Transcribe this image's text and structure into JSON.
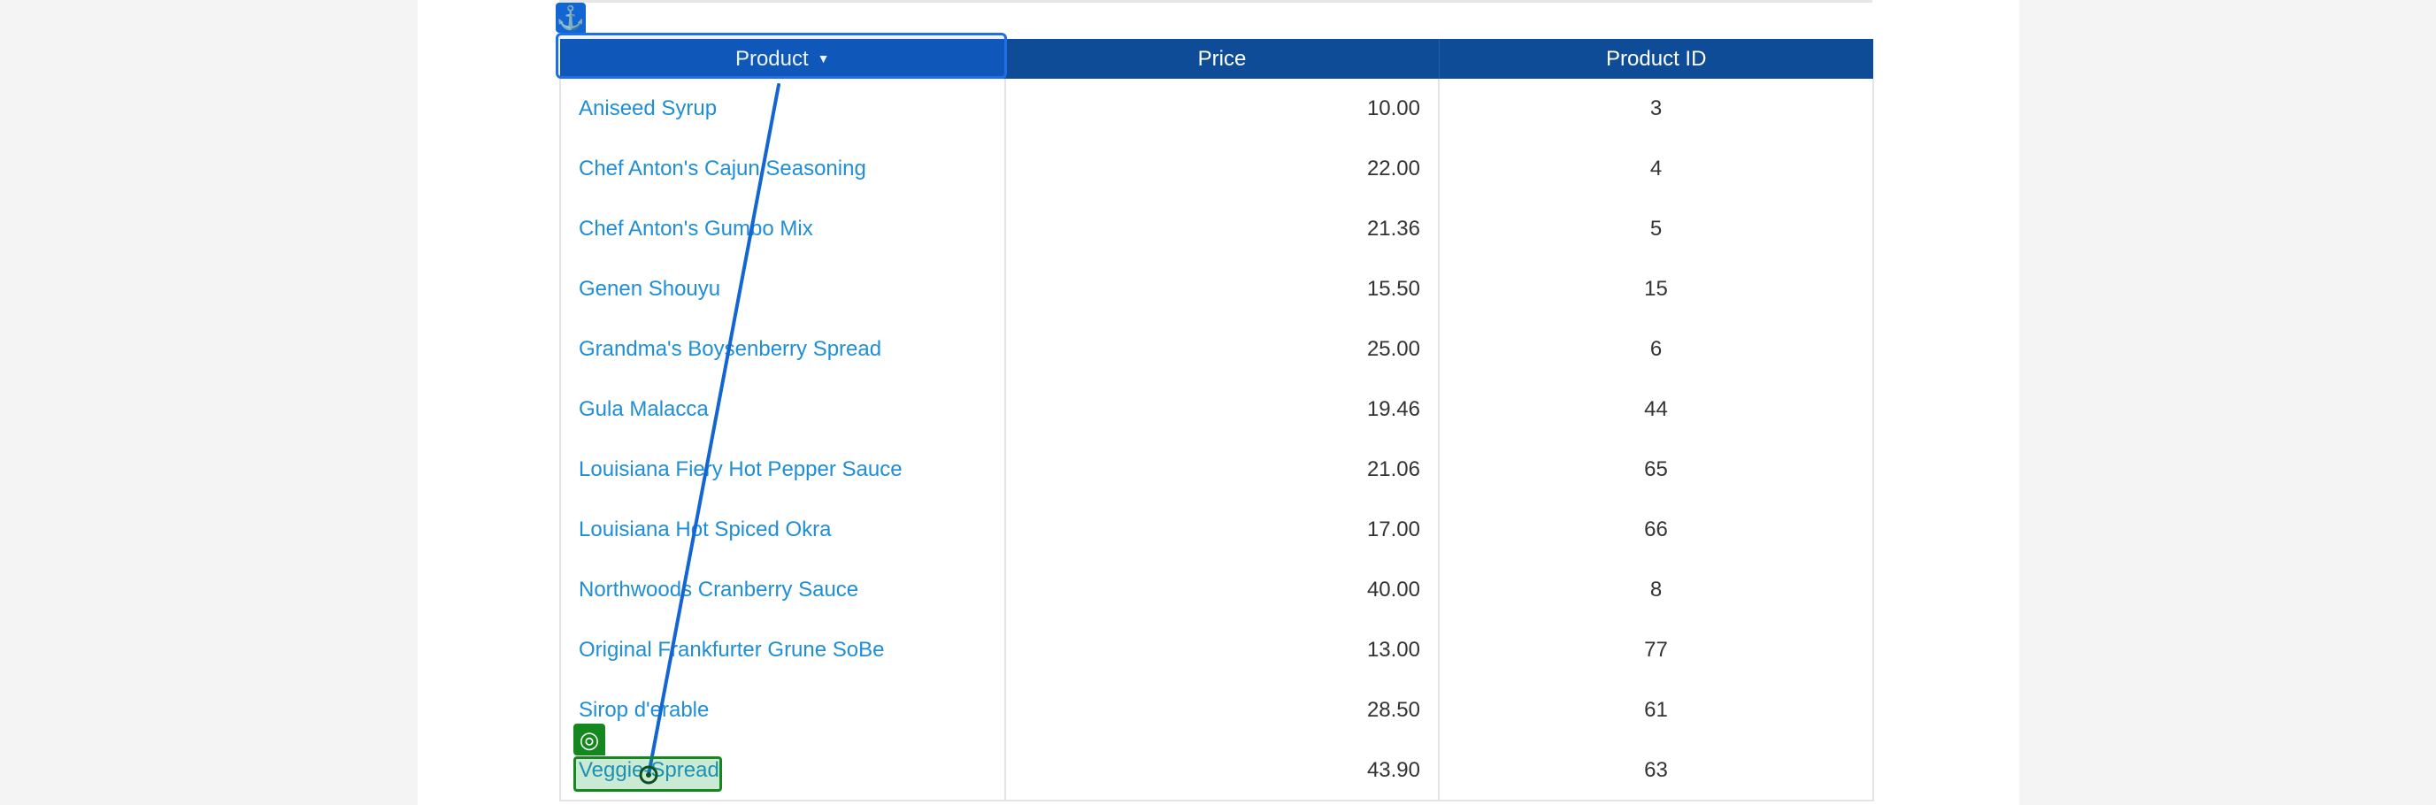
{
  "columns": {
    "product": "Product",
    "product_sort_indicator": "▼",
    "price": "Price",
    "product_id": "Product ID"
  },
  "rows": [
    {
      "product": "Aniseed Syrup",
      "price": "10.00",
      "id": "3"
    },
    {
      "product": "Chef Anton's Cajun Seasoning",
      "price": "22.00",
      "id": "4"
    },
    {
      "product": "Chef Anton's Gumbo Mix",
      "price": "21.36",
      "id": "5"
    },
    {
      "product": "Genen Shouyu",
      "price": "15.50",
      "id": "15"
    },
    {
      "product": "Grandma's Boysenberry Spread",
      "price": "25.00",
      "id": "6"
    },
    {
      "product": "Gula Malacca",
      "price": "19.46",
      "id": "44"
    },
    {
      "product": "Louisiana Fiery Hot Pepper Sauce",
      "price": "21.06",
      "id": "65"
    },
    {
      "product": "Louisiana Hot Spiced Okra",
      "price": "17.00",
      "id": "66"
    },
    {
      "product": "Northwoods Cranberry Sauce",
      "price": "40.00",
      "id": "8"
    },
    {
      "product": "Original Frankfurter Grune SoBe",
      "price": "13.00",
      "id": "77"
    },
    {
      "product": "Sirop d'erable",
      "price": "28.50",
      "id": "61"
    },
    {
      "product": "Veggie-Spread",
      "price": "43.90",
      "id": "63"
    }
  ],
  "overlay": {
    "anchor_icon": "anchor-icon",
    "target_icon": "target-icon",
    "source_color": "#1265d3",
    "target_color": "#14881f"
  },
  "colors": {
    "header_bg": "#0f4c97",
    "link": "#1e8ed6"
  }
}
